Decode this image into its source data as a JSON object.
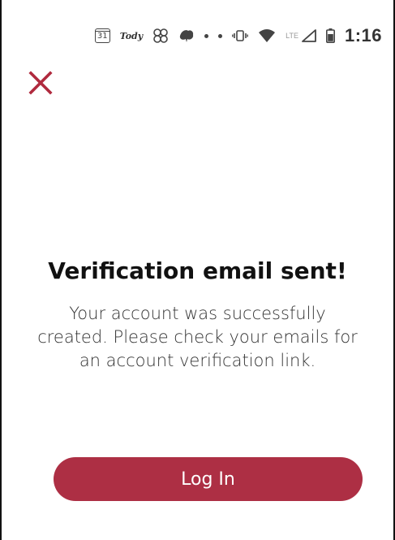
{
  "status_bar": {
    "calendar_day": "31",
    "brand_label": "Tody",
    "lte_label": "LTE",
    "time": "1:16",
    "icons": [
      "calendar-icon",
      "tody-app-icon",
      "pinwheel-icon",
      "leaf-icon",
      "dot-icon",
      "dot-icon",
      "vibrate-icon",
      "wifi-icon",
      "lte-icon",
      "signal-icon",
      "battery-icon"
    ]
  },
  "header": {
    "close_icon": "close-icon"
  },
  "colors": {
    "accent": "#ad2f44",
    "close": "#b02a3e",
    "title_text": "#111111",
    "body_text": "#333333"
  },
  "verification": {
    "title": "Verification email sent!",
    "message": "Your account was successfully created. Please check your emails for an account verification link."
  },
  "actions": {
    "login_label": "Log In"
  }
}
